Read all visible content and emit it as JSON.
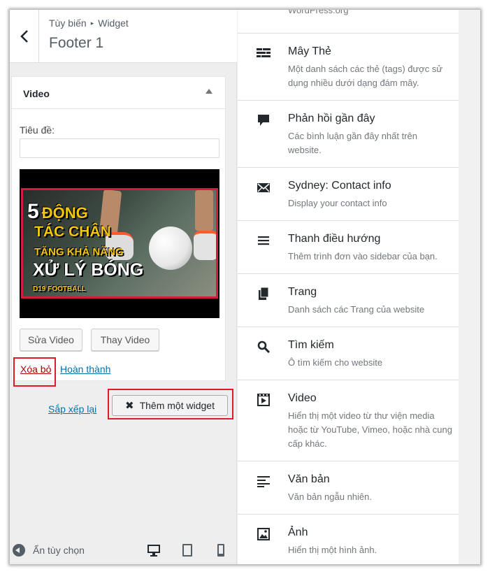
{
  "header": {
    "breadcrumb_1": "Tùy biến",
    "breadcrumb_sep": "▸",
    "breadcrumb_2": "Widget",
    "title": "Footer 1"
  },
  "widget": {
    "title": "Video",
    "field_label": "Tiêu đề:",
    "field_value": "",
    "thumbnail": {
      "line1_number": "5",
      "line1_text": "ĐỘNG",
      "line2": "TÁC CHÂN",
      "line3": "TĂNG KHẢ NĂNG",
      "line4": "XỬ LÝ BÓNG",
      "line5": "D19 FOOTBALL"
    },
    "edit_video_label": "Sửa Video",
    "replace_video_label": "Thay Video",
    "delete_label": "Xóa bỏ",
    "done_label": "Hoàn thành"
  },
  "actions": {
    "reorder_label": "Sắp xếp lại",
    "add_widget_label": "Thêm một widget",
    "add_widget_icon": "✖"
  },
  "footer": {
    "collapse_label": "Ẩn tùy chọn"
  },
  "available_widgets": {
    "top_cut_text": "WordPress.org",
    "items": [
      {
        "name": "Mây Thẻ",
        "desc": "Một danh sách các thẻ (tags) được sử dụng nhiều dưới dạng đám mây.",
        "icon": "tag-cloud-icon"
      },
      {
        "name": "Phản hồi gần đây",
        "desc": "Các bình luận gần đây nhất trên website.",
        "icon": "comment-icon"
      },
      {
        "name": "Sydney: Contact info",
        "desc": "Display your contact info",
        "icon": "email-icon"
      },
      {
        "name": "Thanh điều hướng",
        "desc": "Thêm trình đơn vào sidebar của bạn.",
        "icon": "menu-icon"
      },
      {
        "name": "Trang",
        "desc": "Danh sách các Trang của website",
        "icon": "pages-icon"
      },
      {
        "name": "Tìm kiếm",
        "desc": "Ô tìm kiếm cho website",
        "icon": "search-icon"
      },
      {
        "name": "Video",
        "desc": "Hiển thị một video từ thư viện media hoặc từ YouTube, Vimeo, hoặc nhà cung cấp khác.",
        "icon": "video-icon"
      },
      {
        "name": "Văn bản",
        "desc": "Văn bản ngẫu nhiên.",
        "icon": "text-icon"
      },
      {
        "name": "Ảnh",
        "desc": "Hiển thị một hình ảnh.",
        "icon": "image-icon"
      }
    ]
  },
  "colors": {
    "link": "#0073aa",
    "delete": "#aa0000",
    "highlight": "#e01b24"
  }
}
